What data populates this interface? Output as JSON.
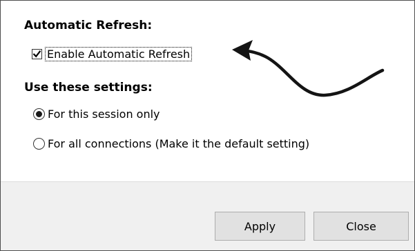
{
  "automatic_refresh": {
    "heading": "Automatic Refresh:",
    "checkbox_label": "Enable Automatic Refresh",
    "checked": true
  },
  "settings": {
    "heading": "Use these settings:",
    "options": [
      {
        "label": "For this session only",
        "selected": true
      },
      {
        "label": "For all connections (Make it the default setting)",
        "selected": false
      }
    ]
  },
  "footer": {
    "apply_label": "Apply",
    "close_label": "Close"
  },
  "icons": {
    "checkbox": "check-mark-icon",
    "annotation": "curved-arrow-icon"
  },
  "colors": {
    "dialog_background": "#ffffff",
    "footer_background": "#f0f0f0",
    "button_background": "#e1e1e1",
    "button_border": "#adadad",
    "frame_border": "#4d4d4d"
  }
}
